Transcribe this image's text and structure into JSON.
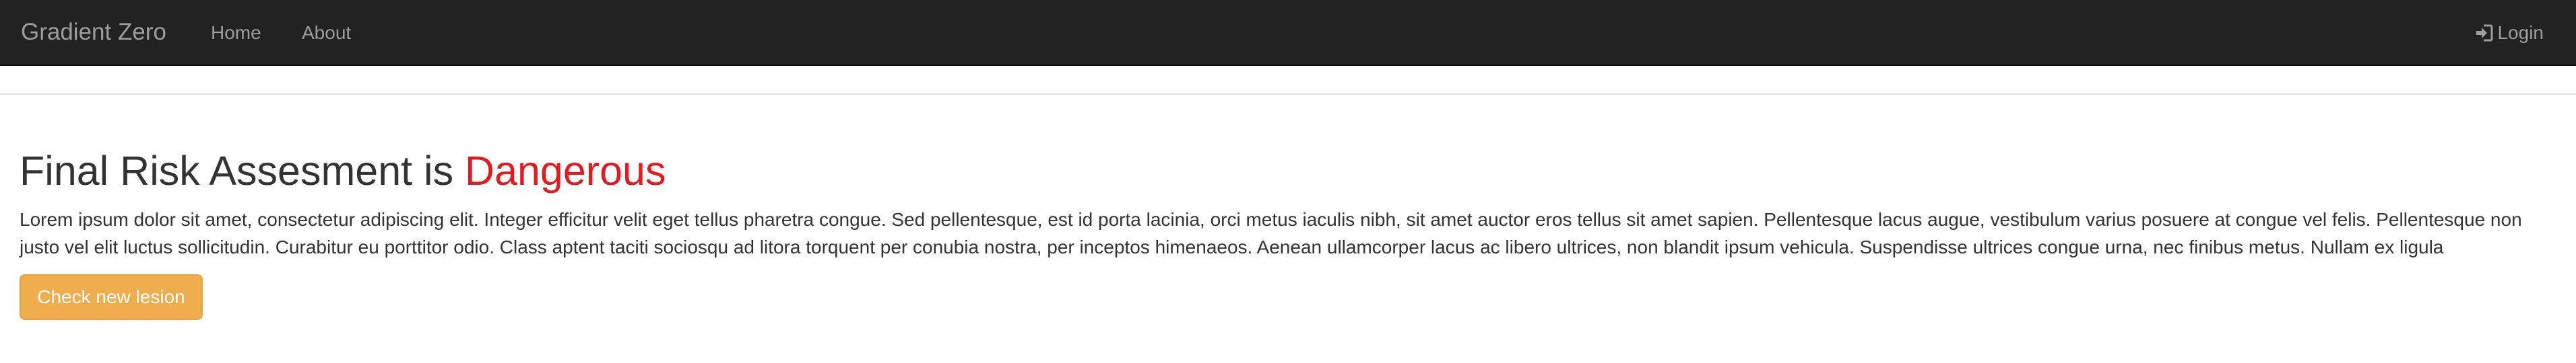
{
  "navbar": {
    "brand": "Gradient Zero",
    "links": [
      {
        "label": "Home"
      },
      {
        "label": "About"
      }
    ],
    "login": {
      "label": "Login",
      "icon": "login-icon"
    }
  },
  "main": {
    "heading_prefix": "Final Risk Assesment is",
    "risk_status": "Dangerous",
    "status_color": "#e8191e",
    "description": "Lorem ipsum dolor sit amet, consectetur adipiscing elit. Integer efficitur velit eget tellus pharetra congue. Sed pellentesque, est id porta lacinia, orci metus iaculis nibh, sit amet auctor eros tellus sit amet sapien. Pellentesque lacus augue, vestibulum varius posuere at congue vel felis. Pellentesque non\njusto vel elit luctus sollicitudin. Curabitur eu porttitor odio. Class aptent taciti sociosqu ad litora torquent per conubia nostra, per inceptos himenaeos. Aenean ullamcorper lacus ac libero ultrices, non blandit ipsum vehicula. Suspendisse ultrices congue urna, nec finibus metus. Nullam ex ligula",
    "button_label": "Check new lesion",
    "button_color": "#f0ad4e"
  }
}
